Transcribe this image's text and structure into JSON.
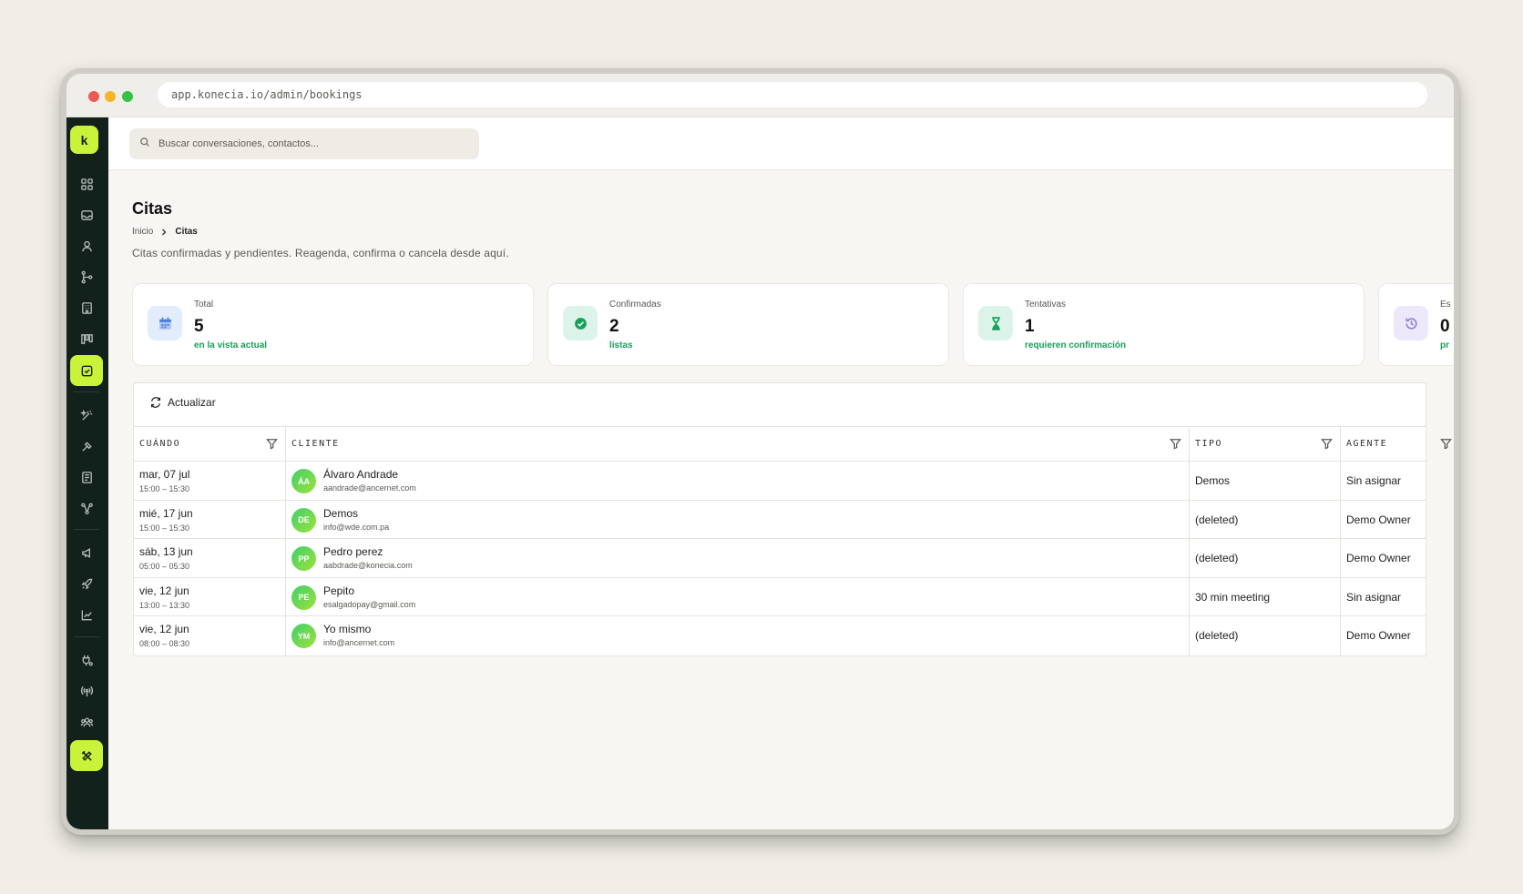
{
  "browser": {
    "url": "app.konecia.io/admin/bookings"
  },
  "sidebar": {
    "logo": "k"
  },
  "topbar": {
    "search_placeholder": "Buscar conversaciones, contactos..."
  },
  "page": {
    "title": "Citas",
    "breadcrumb": [
      "Inicio",
      "Citas"
    ],
    "subtitle": "Citas confirmadas y pendientes. Reagenda, confirma o cancela desde aquí."
  },
  "cards": [
    {
      "label": "Total",
      "value": "5",
      "note": "en la vista actual",
      "icon": "calendar-icon",
      "icon_bg": "#e3ecfb",
      "icon_color": "#4a7fe0"
    },
    {
      "label": "Confirmadas",
      "value": "2",
      "note": "listas",
      "icon": "check-circle-icon",
      "icon_bg": "#dcf3e9",
      "icon_color": "#17a05a"
    },
    {
      "label": "Tentativas",
      "value": "1",
      "note": "requieren confirmación",
      "icon": "hourglass-icon",
      "icon_bg": "#dcf3e9",
      "icon_color": "#17a05a"
    },
    {
      "label": "Es",
      "value": "0",
      "note": "pr",
      "icon": "history-icon",
      "icon_bg": "#ece8fa",
      "icon_color": "#8d80d6"
    }
  ],
  "table": {
    "refresh_label": "Actualizar",
    "columns": [
      "CUÁNDO",
      "CLIENTE",
      "TIPO",
      "AGENTE"
    ],
    "rows": [
      {
        "day": "mar, 07 jul",
        "time": "15:00 – 15:30",
        "initials": "ÁA",
        "name": "Álvaro Andrade",
        "email": "aandrade@ancernet.com",
        "type": "Demos",
        "agent": "Sin asignar"
      },
      {
        "day": "mié, 17 jun",
        "time": "15:00 – 15:30",
        "initials": "DE",
        "name": "Demos",
        "email": "info@wde.com.pa",
        "type": "(deleted)",
        "agent": "Demo Owner"
      },
      {
        "day": "sáb, 13 jun",
        "time": "05:00 – 05:30",
        "initials": "PP",
        "name": "Pedro perez",
        "email": "aabdrade@konecia.com",
        "type": "(deleted)",
        "agent": "Demo Owner"
      },
      {
        "day": "vie, 12 jun",
        "time": "13:00 – 13:30",
        "initials": "PE",
        "name": "Pepito",
        "email": "esalgadopay@gmail.com",
        "type": "30 min meeting",
        "agent": "Sin asignar"
      },
      {
        "day": "vie, 12 jun",
        "time": "08:00 – 08:30",
        "initials": "YM",
        "name": "Yo mismo",
        "email": "info@ancernet.com",
        "type": "(deleted)",
        "agent": "Demo Owner"
      }
    ]
  }
}
